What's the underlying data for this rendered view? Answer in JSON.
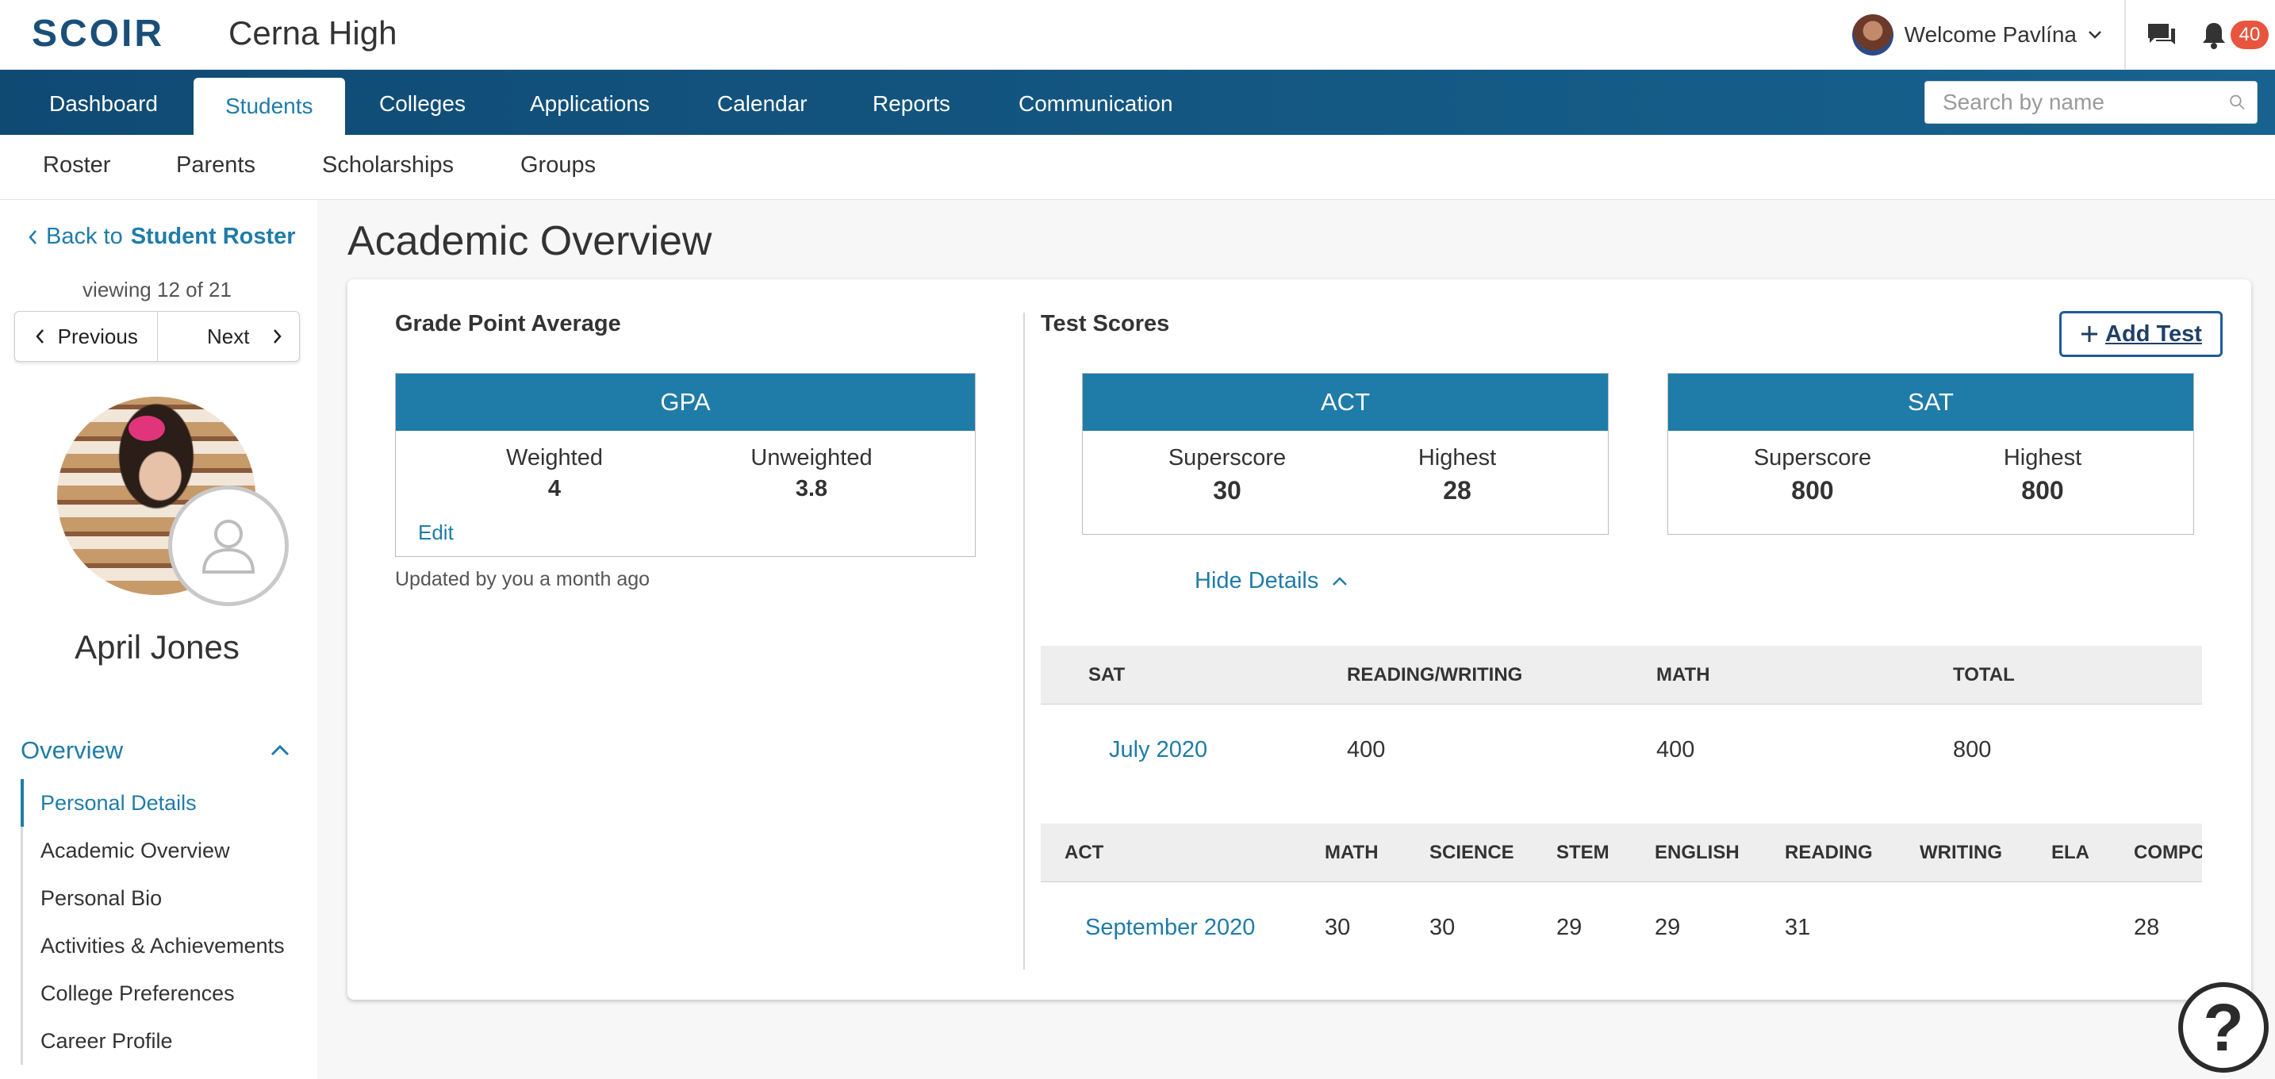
{
  "brand": {
    "logo_text": "SCOIR",
    "school": "Cerna High"
  },
  "user": {
    "welcome": "Welcome Pavlína",
    "notifications": "40"
  },
  "main_nav": {
    "tabs": [
      "Dashboard",
      "Students",
      "Colleges",
      "Applications",
      "Calendar",
      "Reports",
      "Communication"
    ],
    "active": "Students",
    "search_placeholder": "Search by name"
  },
  "sub_nav": {
    "items": [
      "Roster",
      "Parents",
      "Scholarships",
      "Groups"
    ]
  },
  "sidebar": {
    "back_prefix": "Back to",
    "back_target": "Student Roster",
    "viewing": "viewing 12 of 21",
    "previous": "Previous",
    "next": "Next",
    "student_name": "April Jones",
    "overview_label": "Overview",
    "menu": [
      "Personal Details",
      "Academic Overview",
      "Personal Bio",
      "Activities & Achievements",
      "College Preferences",
      "Career Profile"
    ],
    "active_menu": "Personal Details"
  },
  "content": {
    "page_title": "Academic Overview",
    "gpa": {
      "section_title": "Grade Point Average",
      "box_title": "GPA",
      "weighted_label": "Weighted",
      "weighted_value": "4",
      "unweighted_label": "Unweighted",
      "unweighted_value": "3.8",
      "edit": "Edit",
      "updated": "Updated by you a month ago"
    },
    "tests": {
      "section_title": "Test Scores",
      "add_test": "Add Test",
      "hide_details": "Hide Details",
      "act_box": {
        "title": "ACT",
        "superscore_label": "Superscore",
        "superscore": "30",
        "highest_label": "Highest",
        "highest": "28"
      },
      "sat_box": {
        "title": "SAT",
        "superscore_label": "Superscore",
        "superscore": "800",
        "highest_label": "Highest",
        "highest": "800"
      },
      "sat_table": {
        "headers": [
          "SAT",
          "READING/WRITING",
          "MATH",
          "TOTAL"
        ],
        "rows": [
          [
            "July 2020",
            "400",
            "400",
            "800"
          ]
        ]
      },
      "act_table": {
        "headers": [
          "ACT",
          "MATH",
          "SCIENCE",
          "STEM",
          "ENGLISH",
          "READING",
          "WRITING",
          "ELA",
          "COMPO"
        ],
        "rows": [
          [
            "September 2020",
            "30",
            "30",
            "29",
            "29",
            "31",
            "",
            "",
            "28"
          ]
        ]
      }
    }
  },
  "help": {
    "glyph": "?"
  },
  "colors": {
    "brand": "#1a4f7a",
    "accent": "#1f7ca8",
    "nav": "#0f4a73",
    "badge": "#e8553e"
  }
}
